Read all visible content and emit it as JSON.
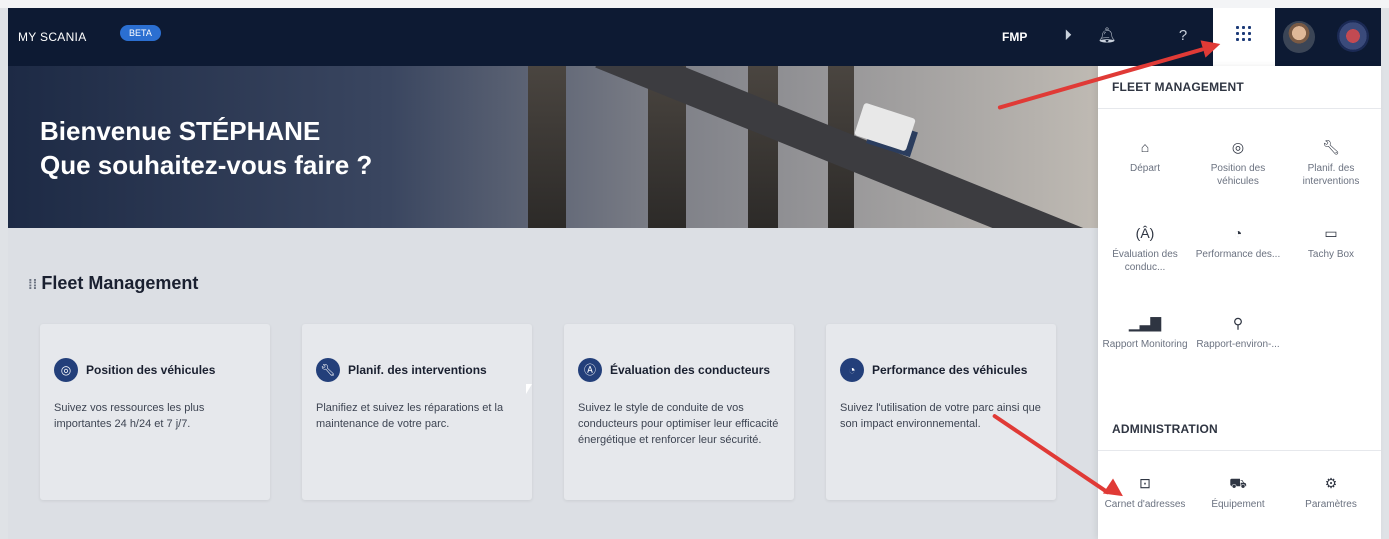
{
  "header": {
    "brand": "MY SCANIA",
    "beta": "BETA",
    "fmp": "FMP"
  },
  "hero": {
    "line1": "Bienvenue STÉPHANE",
    "line2": "Que souhaitez-vous faire ?"
  },
  "section": {
    "title": "Fleet Management",
    "cards": [
      {
        "title": "Position des véhicules",
        "text": "Suivez vos ressources les plus importantes 24 h/24 et 7 j/7.",
        "icon": "location-pin-icon"
      },
      {
        "title": "Planif. des interventions",
        "text": "Planifiez et suivez les réparations et la maintenance de votre parc.",
        "icon": "wrench-icon"
      },
      {
        "title": "Évaluation des conducteurs",
        "text": "Suivez le style de conduite de vos conducteurs pour optimiser leur efficacité énergétique et renforcer leur sécurité.",
        "icon": "driver-evaluation-icon"
      },
      {
        "title": "Performance des véhicules",
        "text": "Suivez l'utilisation de votre parc ainsi que son impact environnemental.",
        "icon": "speedometer-icon"
      }
    ]
  },
  "panel": {
    "fleet_heading": "FLEET MANAGEMENT",
    "fleet_tiles": [
      {
        "label": "Départ",
        "icon": "home-icon"
      },
      {
        "label": "Position des véhicules",
        "icon": "location-pin-icon"
      },
      {
        "label": "Planif. des interventions",
        "icon": "wrench-icon"
      },
      {
        "label": "Évaluation des conduc...",
        "icon": "driver-evaluation-icon"
      },
      {
        "label": "Performance des...",
        "icon": "speedometer-icon"
      },
      {
        "label": "Tachy Box",
        "icon": "tachy-box-icon"
      },
      {
        "label": "Rapport Monitoring",
        "icon": "bar-chart-icon"
      },
      {
        "label": "Rapport-environ-...",
        "icon": "sprout-icon"
      }
    ],
    "admin_heading": "ADMINISTRATION",
    "admin_tiles": [
      {
        "label": "Carnet d'adresses",
        "icon": "address-book-icon"
      },
      {
        "label": "Équipement",
        "icon": "truck-front-icon"
      },
      {
        "label": "Paramètres",
        "icon": "gear-icon"
      }
    ]
  },
  "colors": {
    "topbar": "#0d1a33",
    "accent": "#2b6fd1",
    "annotation_arrow": "#e03a36"
  }
}
